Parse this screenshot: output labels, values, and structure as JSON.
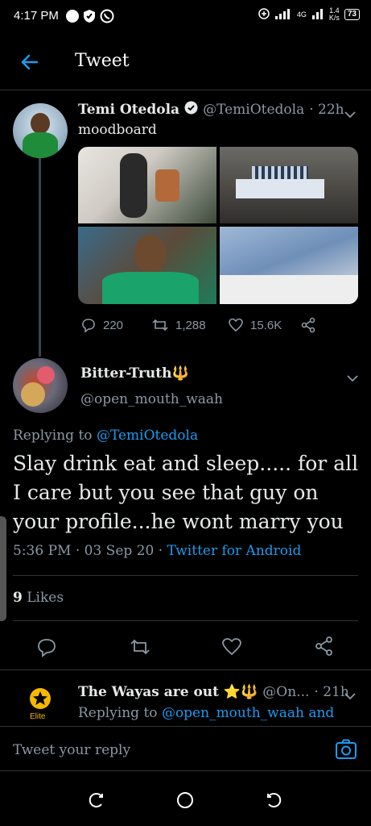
{
  "status_bar": {
    "time": "4:17 PM",
    "network": "4G",
    "speed_value": "1.4",
    "speed_unit": "K/s",
    "battery": "73"
  },
  "header": {
    "title": "Tweet",
    "back_icon": "arrow-left-icon"
  },
  "original_tweet": {
    "display_name": "Temi Otedola",
    "handle": "@TemiOtedola",
    "time": "· 22h",
    "text": "moodboard",
    "verified": true,
    "stats": {
      "replies": "220",
      "retweets": "1,288",
      "likes": "15.6K"
    }
  },
  "reply_tweet": {
    "display_name": "Bitter-Truth🔱",
    "handle": "@open_mouth_waah",
    "replying_prefix": "Replying to",
    "replying_to": "@TemiOtedola",
    "text": "Slay drink eat and sleep..... for all I care but you see that guy on your profile...he wont marry you",
    "time": "5:36 PM · 03 Sep 20 ·",
    "source": "Twitter for Android",
    "likes_count": "9",
    "likes_label": "Likes"
  },
  "next_reply": {
    "display_name": "The Wayas are out ⭐🔱",
    "handle": "@On...",
    "time": "· 21h",
    "replying_prefix": "Replying to",
    "replying_to": "@open_mouth_waah and",
    "avatar_text": "Elite"
  },
  "compose": {
    "placeholder": "Tweet your reply"
  },
  "colors": {
    "accent": "#1d9bf0",
    "background": "#000000",
    "muted": "#8b98a5",
    "divider": "#2f3336"
  }
}
